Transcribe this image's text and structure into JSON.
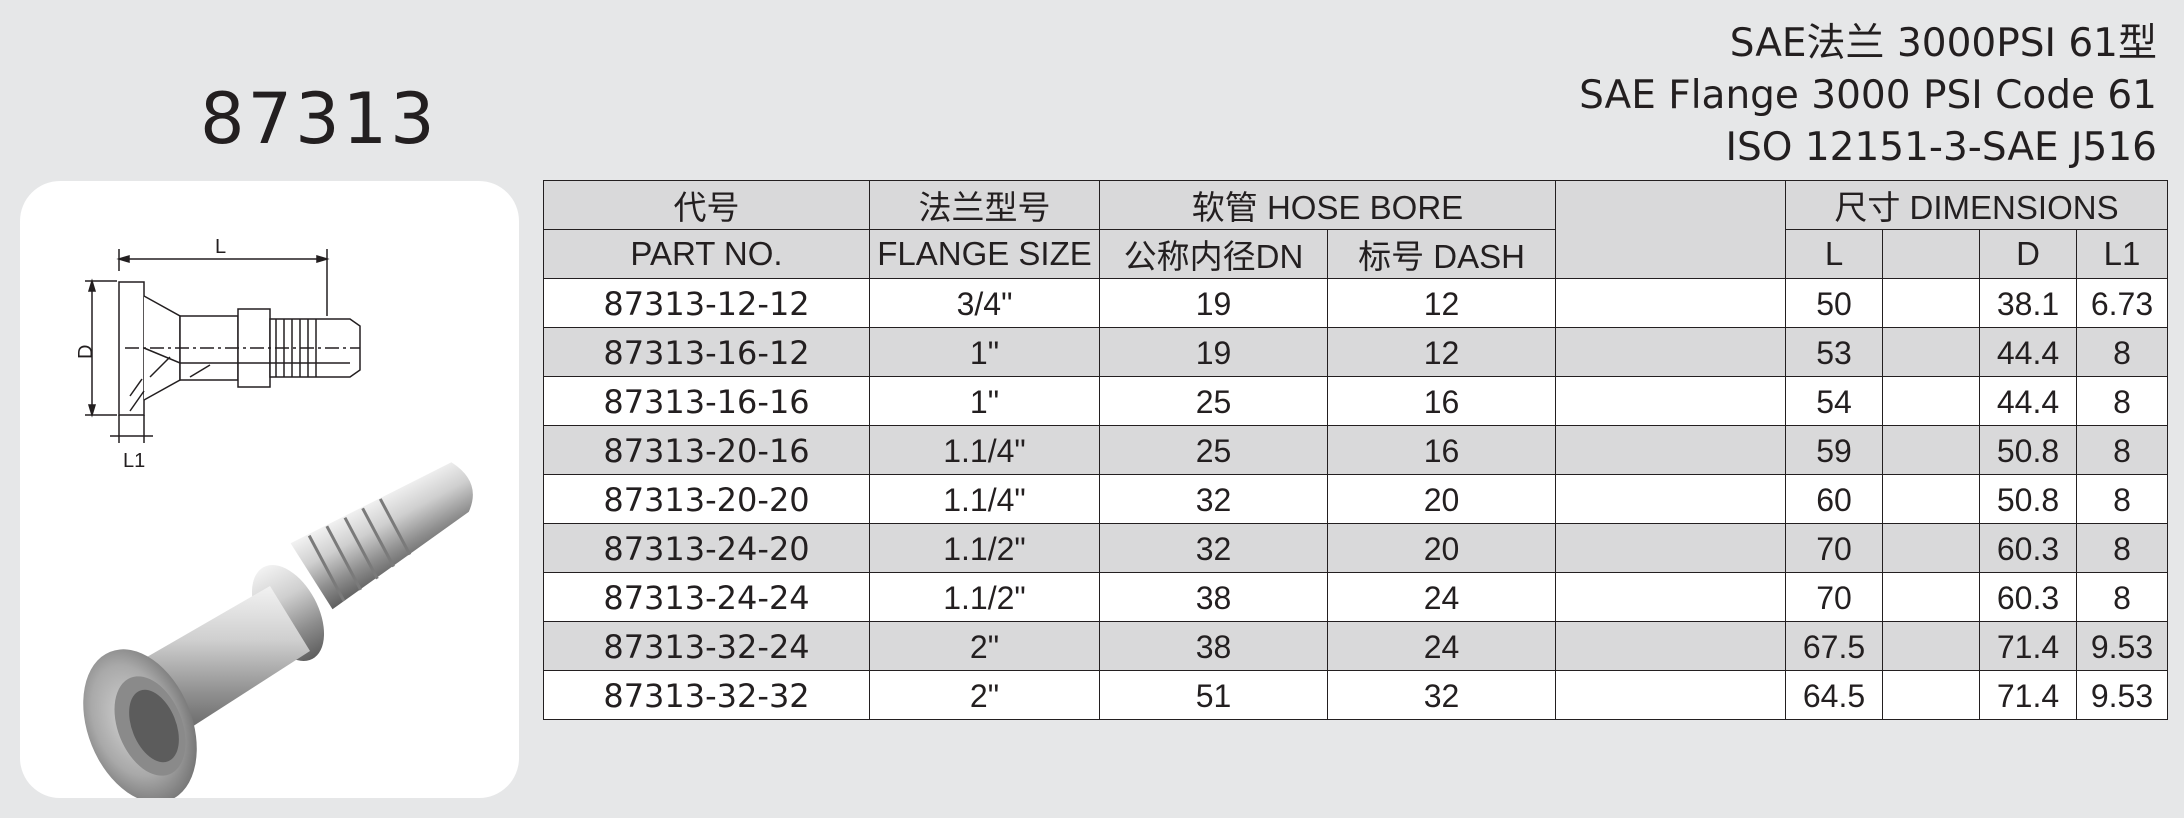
{
  "model": "87313",
  "title_lines": [
    "SAE法兰 3000PSI 61型",
    "SAE Flange 3000 PSI Code 61",
    "ISO 12151-3-SAE J516"
  ],
  "drawing_labels": {
    "length": "L",
    "diameter": "D",
    "flange_thickness": "L1"
  },
  "table": {
    "header": {
      "part_cn": "代号",
      "part_en": "PART NO.",
      "flange_cn": "法兰型号",
      "flange_en": "FLANGE  SIZE",
      "hose_bore": "软管 HOSE BORE",
      "dn": "公称内径DN",
      "dash": "标号  DASH",
      "dimensions": "尺寸  DIMENSIONS",
      "l": "L",
      "d": "D",
      "l1": "L1"
    },
    "rows": [
      {
        "part": "87313-12-12",
        "flange": "3/4\"",
        "dn": "19",
        "dash": "12",
        "l": "50",
        "d": "38.1",
        "l1": "6.73"
      },
      {
        "part": "87313-16-12",
        "flange": "1\"",
        "dn": "19",
        "dash": "12",
        "l": "53",
        "d": "44.4",
        "l1": "8"
      },
      {
        "part": "87313-16-16",
        "flange": "1\"",
        "dn": "25",
        "dash": "16",
        "l": "54",
        "d": "44.4",
        "l1": "8"
      },
      {
        "part": "87313-20-16",
        "flange": "1.1/4\"",
        "dn": "25",
        "dash": "16",
        "l": "59",
        "d": "50.8",
        "l1": "8"
      },
      {
        "part": "87313-20-20",
        "flange": "1.1/4\"",
        "dn": "32",
        "dash": "20",
        "l": "60",
        "d": "50.8",
        "l1": "8"
      },
      {
        "part": "87313-24-20",
        "flange": "1.1/2\"",
        "dn": "32",
        "dash": "20",
        "l": "70",
        "d": "60.3",
        "l1": "8"
      },
      {
        "part": "87313-24-24",
        "flange": "1.1/2\"",
        "dn": "38",
        "dash": "24",
        "l": "70",
        "d": "60.3",
        "l1": "8"
      },
      {
        "part": "87313-32-24",
        "flange": "2\"",
        "dn": "38",
        "dash": "24",
        "l": "67.5",
        "d": "71.4",
        "l1": "9.53"
      },
      {
        "part": "87313-32-32",
        "flange": "2\"",
        "dn": "51",
        "dash": "32",
        "l": "64.5",
        "d": "71.4",
        "l1": "9.53"
      }
    ]
  }
}
